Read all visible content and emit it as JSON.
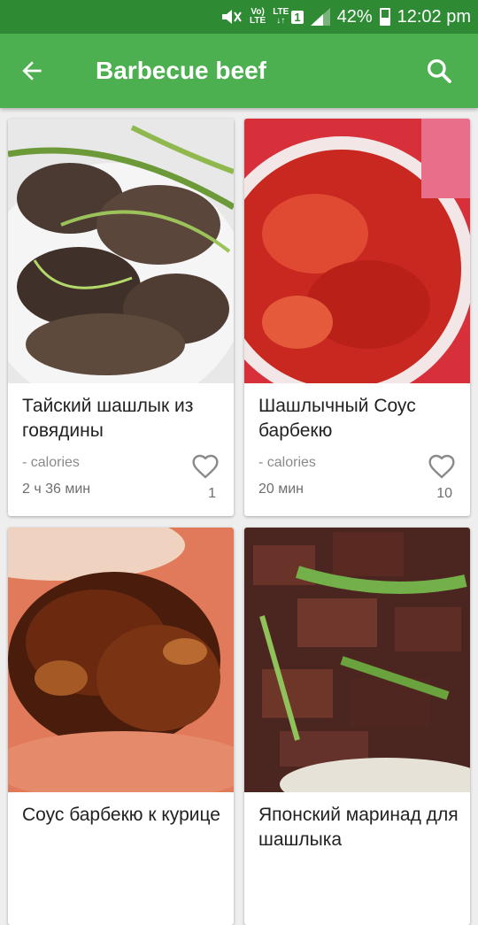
{
  "status_bar": {
    "volte_top": "Vo)",
    "volte_bottom": "LTE",
    "lte_top": "LTE",
    "lte_bottom": "↓↑",
    "sim": "1",
    "battery_percent": "42%",
    "battery_level": 0.42,
    "time": "12:02 pm"
  },
  "app_bar": {
    "title": "Barbecue beef",
    "back_icon": "arrow-back-icon",
    "search_icon": "search-icon",
    "color": "#4caf50"
  },
  "recipes": [
    {
      "name": "Тайский шашлык из говядины",
      "calories": "- calories",
      "time": "2 ч 36 мин",
      "likes": "1"
    },
    {
      "name": "Шашлычный Соус барбекю",
      "calories": "- calories",
      "time": "20 мин",
      "likes": "10"
    },
    {
      "name": "Соус барбекю к курице"
    },
    {
      "name": "Японский маринад для шашлыка"
    }
  ]
}
